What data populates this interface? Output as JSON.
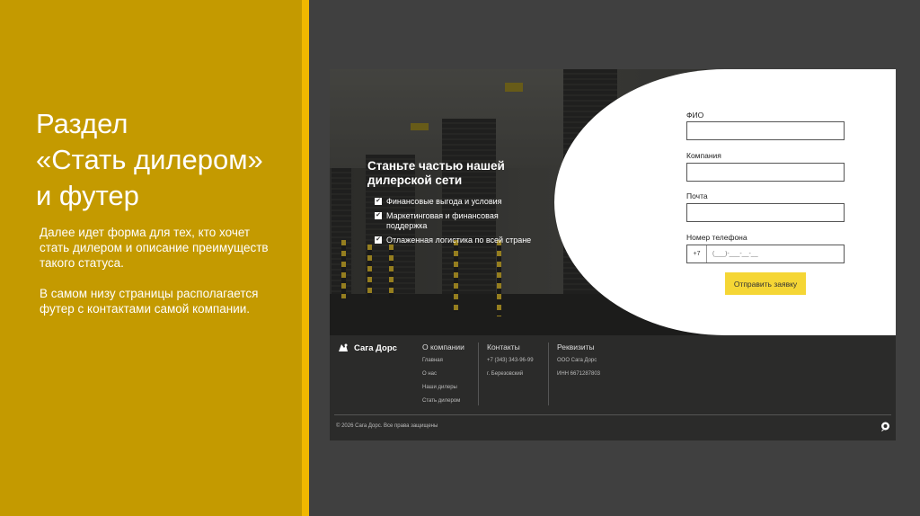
{
  "slide": {
    "title": "Раздел\n«Стать дилером»\nи футер",
    "paragraph1": "Далее идет форма для тех, кто хочет стать дилером и описание преимуществ такого статуса.",
    "paragraph2": "В самом низу страницы располагается футер с контактами самой компании."
  },
  "hero": {
    "title": "Станьте частью нашей дилерской сети",
    "benefits": [
      "Финансовые выгода и условия",
      "Маркетинговая и финансовая поддержка",
      "Отлаженная логистика по всей стране"
    ]
  },
  "form": {
    "fio_label": "ФИО",
    "company_label": "Компания",
    "email_label": "Почта",
    "phone_label": "Номер телефона",
    "phone_prefix": "+7",
    "phone_placeholder": "(___)-___-__-__",
    "submit_label": "Отправить заявку"
  },
  "footer": {
    "brand": "Сага Дорс",
    "about": {
      "heading": "О компании",
      "links": [
        "Главная",
        "О нас",
        "Наши дилеры",
        "Стать дилером"
      ]
    },
    "contacts": {
      "heading": "Контакты",
      "items": [
        "+7 (343) 343-96-99",
        "г. Березовский"
      ]
    },
    "requisites": {
      "heading": "Реквизиты",
      "items": [
        "ООО Сага Дорс",
        "ИНН 6671287803"
      ]
    },
    "copyright": "© 2026 Сага Дорс. Все права защищены"
  },
  "colors": {
    "gold_panel": "#c49a00",
    "accent_stripe": "#f0b800",
    "button_yellow": "#f5d635",
    "footer_bg": "#2b2b2a"
  }
}
